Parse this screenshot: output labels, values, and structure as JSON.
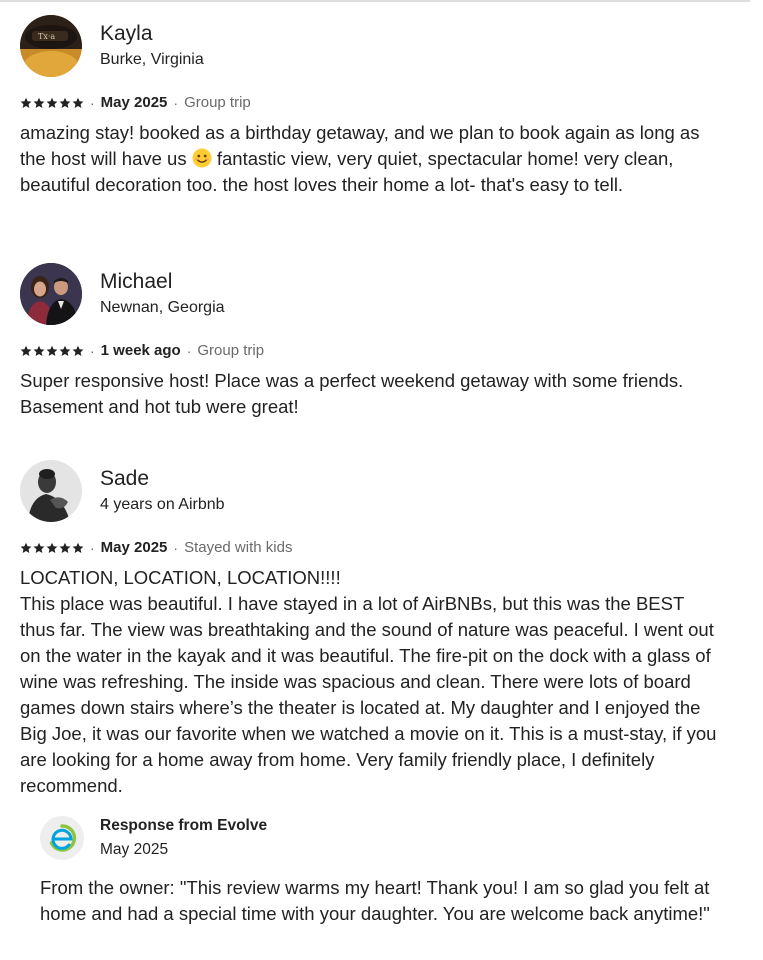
{
  "reviews": [
    {
      "name": "Kayla",
      "location": "Burke, Virginia",
      "rating": 5,
      "date": "May 2025",
      "trip_type": "Group trip",
      "text_before_emoji": "amazing stay! booked as a birthday getaway, and we plan to book again as long as the host will have us ",
      "emoji_icon": "smiling-face-emoji",
      "text_after_emoji": " fantastic view, very quiet, spectacular home! very clean, beautiful decoration too. the host loves their home a lot- that's easy to tell."
    },
    {
      "name": "Michael",
      "location": "Newnan, Georgia",
      "rating": 5,
      "date": "1 week ago",
      "trip_type": "Group trip",
      "text": "Super responsive host! Place was a perfect weekend getaway with some friends. Basement and hot tub were great!"
    },
    {
      "name": "Sade",
      "location": "4 years on Airbnb",
      "rating": 5,
      "date": "May 2025",
      "trip_type": "Stayed with kids",
      "text": "LOCATION, LOCATION, LOCATION!!!!\nThis place was beautiful. I have stayed in a lot of AirBNBs, but this was the BEST thus far. The view was breathtaking and the sound of nature was peaceful. I went out on the water in the kayak and it was beautiful. The fire-pit on the dock with a glass of wine was refreshing. The inside was spacious and clean. There were lots of board games down stairs where’s the theater is located at. My daughter and I enjoyed the Big Joe, it was our favorite when we watched a movie on it. This is a must-stay, if you are looking for a home away from home. Very family friendly place, I definitely recommend.",
      "response": {
        "title": "Response from Evolve",
        "date": "May 2025",
        "text": "From the owner: \"This review warms my heart! Thank you! I am so glad you felt at home and had a special time with your daughter. You are welcome back anytime!\""
      }
    }
  ],
  "icons": {
    "star": "star-icon",
    "evolve_logo": "evolve-logo-icon"
  },
  "colors": {
    "text": "#222222",
    "muted": "#6a6a6a",
    "evolve_green": "#8cc63f",
    "evolve_blue": "#00a3e0"
  }
}
